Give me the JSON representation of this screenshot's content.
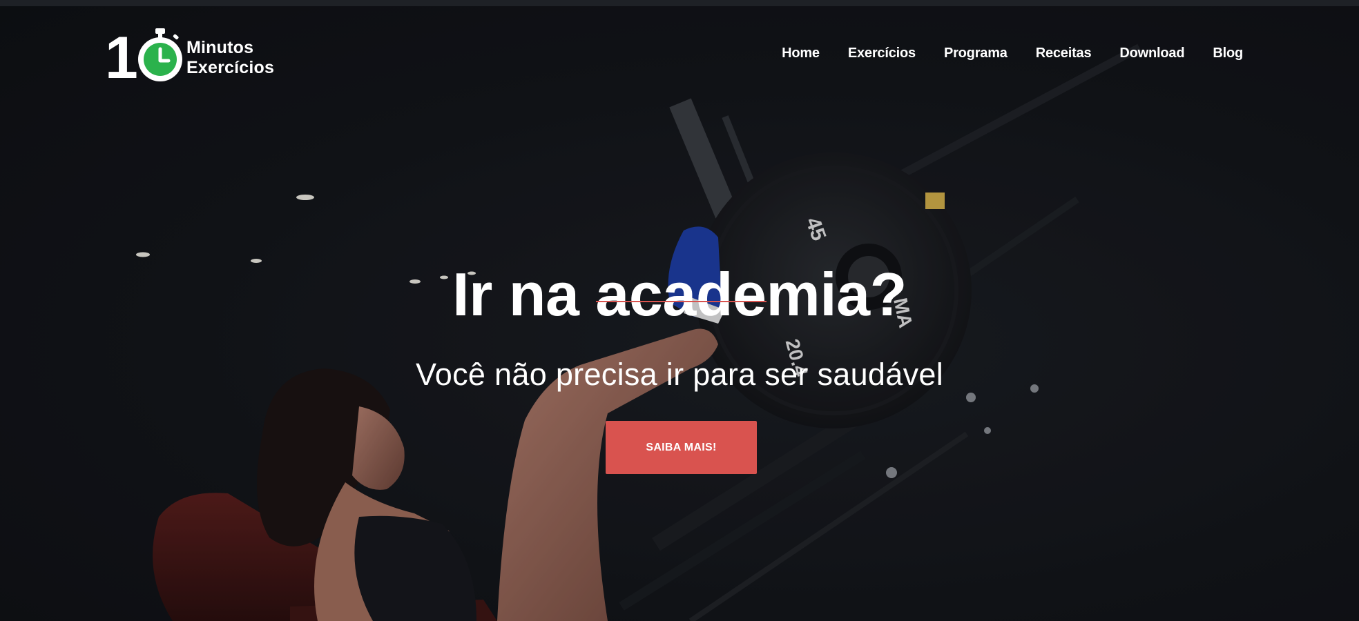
{
  "brand": {
    "logo_number": "1",
    "name_line1": "Minutos",
    "name_line2": "Exercícios",
    "accent_color": "#2bb24c"
  },
  "nav": {
    "items": [
      {
        "label": "Home"
      },
      {
        "label": "Exercícios"
      },
      {
        "label": "Programa"
      },
      {
        "label": "Receitas"
      },
      {
        "label": "Download"
      },
      {
        "label": "Blog"
      }
    ]
  },
  "hero": {
    "title": "Ir na academia?",
    "subtitle": "Você não precisa ir para ser saudável",
    "cta_label": "SAIBA MAIS!",
    "cta_color": "#d9534f",
    "divider_color": "#d9534f",
    "background_image": "woman-leg-press-gym-photo"
  },
  "colors": {
    "page_background": "#111317",
    "text": "#ffffff"
  }
}
